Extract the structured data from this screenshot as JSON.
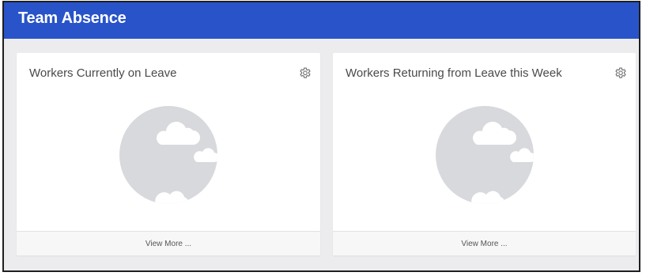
{
  "header": {
    "title": "Team Absence",
    "background_color": "#2853c9"
  },
  "cards": [
    {
      "title": "Workers Currently on Leave",
      "settings_icon": "gear-icon",
      "illustration": "empty-state-cloud-icon",
      "footer_link": "View More ..."
    },
    {
      "title": "Workers Returning from Leave this Week",
      "settings_icon": "gear-icon",
      "illustration": "empty-state-cloud-icon",
      "footer_link": "View More ..."
    }
  ]
}
